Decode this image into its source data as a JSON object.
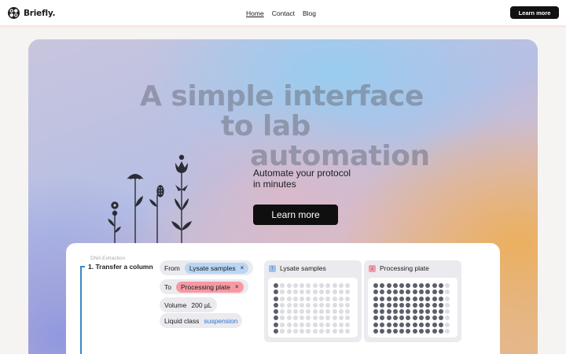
{
  "brand": {
    "name": "Briefly."
  },
  "nav": {
    "home": "Home",
    "contact": "Contact",
    "blog": "Blog"
  },
  "header": {
    "cta": "Learn more"
  },
  "hero": {
    "headline": [
      "A simple interface",
      "to lab",
      "automation"
    ],
    "subtitle": [
      "Automate your protocol",
      "in minutes"
    ],
    "cta": "Learn more"
  },
  "protocol": {
    "section_label": "DNA Extraction",
    "step": "1. Transfer a column",
    "from": {
      "label": "From",
      "value": "Lysate samples",
      "remove": "×"
    },
    "to": {
      "label": "To",
      "value": "Processing plate",
      "remove": "×"
    },
    "volume": {
      "label": "Volume",
      "value": "200 µL"
    },
    "liquid_class": {
      "label": "Liquid class",
      "value": "suspension"
    }
  },
  "plates": {
    "source": {
      "title": "Lysate samples",
      "icon": "arrow-up-icon",
      "rows": 8,
      "cols": 12,
      "filled_columns": [
        1
      ]
    },
    "destination": {
      "title": "Processing plate",
      "icon": "arrow-down-icon",
      "rows": 8,
      "cols": 12,
      "filled_columns": [
        1,
        2,
        3,
        4,
        5,
        6,
        7,
        8,
        9,
        10,
        11
      ]
    }
  },
  "colors": {
    "accent_blue": "#3d85c6",
    "chip_blue": "#b9d6f5",
    "chip_pink": "#f59aa3",
    "button_dark": "#111111"
  }
}
